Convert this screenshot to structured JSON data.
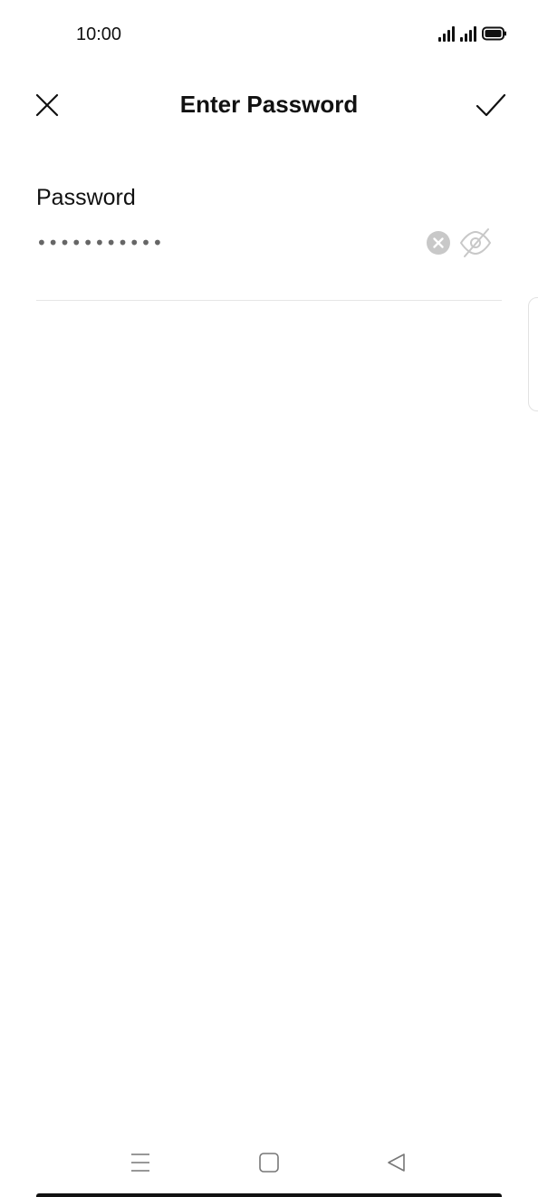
{
  "status_bar": {
    "time": "10:00",
    "icons": [
      "signal-icon",
      "signal-icon",
      "battery-icon"
    ]
  },
  "app_bar": {
    "title": "Enter Password",
    "close_icon": "close-icon",
    "confirm_icon": "checkmark-icon"
  },
  "form": {
    "password_label": "Password",
    "password_value": "•••••••••••",
    "clear_icon": "clear-icon",
    "visibility_icon": "eye-off-icon"
  },
  "nav_bar": {
    "icons": [
      "menu-icon",
      "home-icon",
      "back-icon"
    ]
  },
  "colors": {
    "text": "#111111",
    "icon_gray": "#c8c8c8",
    "divider": "#e6e6e6",
    "background": "#ffffff"
  }
}
